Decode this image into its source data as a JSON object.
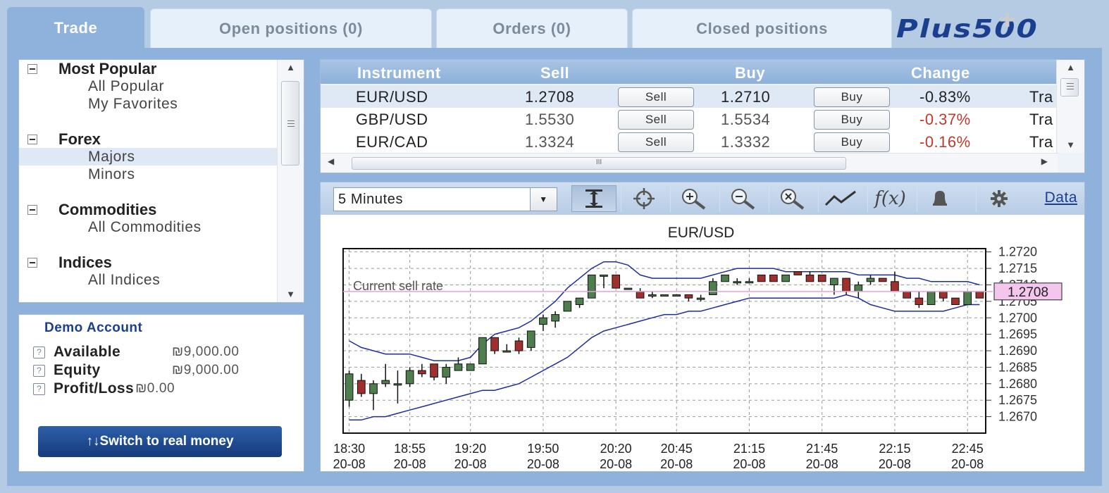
{
  "tabs": [
    {
      "label": "Trade",
      "active": true
    },
    {
      "label": "Open positions (0)",
      "active": false
    },
    {
      "label": "Orders (0)",
      "active": false
    },
    {
      "label": "Closed positions",
      "active": false
    }
  ],
  "brand": {
    "logo_text": "Plus500",
    "color": "#1b3f8f"
  },
  "tree": {
    "groups": [
      {
        "label": "Most Popular",
        "items": [
          "All Popular",
          "My Favorites"
        ]
      },
      {
        "label": "Forex",
        "items": [
          "Majors",
          "Minors"
        ],
        "selected": "Majors"
      },
      {
        "label": "Commodities",
        "items": [
          "All Commodities"
        ]
      },
      {
        "label": "Indices",
        "items": [
          "All Indices"
        ]
      }
    ]
  },
  "account": {
    "title": "Demo Account",
    "rows": [
      {
        "label": "Available",
        "value": "₪9,000.00"
      },
      {
        "label": "Equity",
        "value": "₪9,000.00"
      },
      {
        "label": "Profit/Loss",
        "value": "₪0.00"
      }
    ],
    "switch_button": "↑↓Switch to real money"
  },
  "instruments": {
    "headers": {
      "instrument": "Instrument",
      "sell": "Sell",
      "buy": "Buy",
      "change": "Change"
    },
    "rows": [
      {
        "name": "EUR/USD",
        "sell": "1.2708",
        "sell_btn": "Sell",
        "buy": "1.2710",
        "buy_btn": "Buy",
        "change": "-0.83%",
        "trade": "Tra"
      },
      {
        "name": "GBP/USD",
        "sell": "1.5530",
        "sell_btn": "Sell",
        "buy": "1.5534",
        "buy_btn": "Buy",
        "change": "-0.37%",
        "trade": "Tra"
      },
      {
        "name": "EUR/CAD",
        "sell": "1.3324",
        "sell_btn": "Sell",
        "buy": "1.3332",
        "buy_btn": "Buy",
        "change": "-0.16%",
        "trade": "Tra"
      }
    ],
    "hscroll_grip": "III",
    "colors": {
      "negative": "#c0392b"
    }
  },
  "toolbar": {
    "period": "5 Minutes",
    "tools": [
      "cursor-icon",
      "crosshair-icon",
      "zoom-in-icon",
      "zoom-out-icon",
      "zoom-reset-icon",
      "line-icon",
      "function-icon",
      "bell-icon",
      "gear-icon"
    ],
    "function_label": "f(x)",
    "data_link": "Data"
  },
  "chart_data": {
    "type": "candlestick",
    "title": "EUR/USD",
    "ylim": [
      1.2665,
      1.2721
    ],
    "yticks": [
      "1.2720",
      "1.2715",
      "1.2710",
      "1.2705",
      "1.2700",
      "1.2695",
      "1.2690",
      "1.2685",
      "1.2680",
      "1.2675",
      "1.2670"
    ],
    "xticks": [
      {
        "time": "18:30",
        "date": "20-08",
        "index": 0
      },
      {
        "time": "18:55",
        "date": "20-08",
        "index": 5
      },
      {
        "time": "19:20",
        "date": "20-08",
        "index": 10
      },
      {
        "time": "19:50",
        "date": "20-08",
        "index": 16
      },
      {
        "time": "20:20",
        "date": "20-08",
        "index": 22
      },
      {
        "time": "20:45",
        "date": "20-08",
        "index": 27
      },
      {
        "time": "21:15",
        "date": "20-08",
        "index": 33
      },
      {
        "time": "21:45",
        "date": "20-08",
        "index": 39
      },
      {
        "time": "22:15",
        "date": "20-08",
        "index": 45
      },
      {
        "time": "22:45",
        "date": "20-08",
        "index": 51
      }
    ],
    "current_rate": {
      "label": "Current sell rate",
      "value": 1.2708,
      "display": "1.2708"
    },
    "grid": true,
    "colors": {
      "up": "#4e7d4e",
      "down": "#a0302e",
      "band": "#1f2d9c",
      "rate_line": "#e3a3d6",
      "rate_badge": "#f4c6ee"
    },
    "candles": [
      {
        "o": 1.2675,
        "h": 1.2684,
        "l": 1.2673,
        "c": 1.2683
      },
      {
        "o": 1.2681,
        "h": 1.2683,
        "l": 1.2676,
        "c": 1.2677
      },
      {
        "o": 1.2677,
        "h": 1.2681,
        "l": 1.2672,
        "c": 1.268
      },
      {
        "o": 1.268,
        "h": 1.2686,
        "l": 1.2679,
        "c": 1.2681
      },
      {
        "o": 1.268,
        "h": 1.2684,
        "l": 1.2674,
        "c": 1.268
      },
      {
        "o": 1.268,
        "h": 1.2685,
        "l": 1.2679,
        "c": 1.2684
      },
      {
        "o": 1.2684,
        "h": 1.2686,
        "l": 1.2682,
        "c": 1.2683
      },
      {
        "o": 1.2686,
        "h": 1.2686,
        "l": 1.2681,
        "c": 1.2682
      },
      {
        "o": 1.2682,
        "h": 1.2686,
        "l": 1.268,
        "c": 1.2685
      },
      {
        "o": 1.2684,
        "h": 1.2688,
        "l": 1.2684,
        "c": 1.2686
      },
      {
        "o": 1.2684,
        "h": 1.2686,
        "l": 1.2684,
        "c": 1.2686
      },
      {
        "o": 1.2686,
        "h": 1.2694,
        "l": 1.2686,
        "c": 1.2694
      },
      {
        "o": 1.2694,
        "h": 1.2694,
        "l": 1.2689,
        "c": 1.269
      },
      {
        "o": 1.269,
        "h": 1.2692,
        "l": 1.269,
        "c": 1.269
      },
      {
        "o": 1.2693,
        "h": 1.2694,
        "l": 1.2689,
        "c": 1.269
      },
      {
        "o": 1.2691,
        "h": 1.2696,
        "l": 1.269,
        "c": 1.2696
      },
      {
        "o": 1.2698,
        "h": 1.2701,
        "l": 1.2696,
        "c": 1.27
      },
      {
        "o": 1.2699,
        "h": 1.2702,
        "l": 1.2697,
        "c": 1.2701
      },
      {
        "o": 1.2702,
        "h": 1.2705,
        "l": 1.2702,
        "c": 1.2705
      },
      {
        "o": 1.2704,
        "h": 1.2706,
        "l": 1.2703,
        "c": 1.2706
      },
      {
        "o": 1.2706,
        "h": 1.2713,
        "l": 1.2706,
        "c": 1.2713
      },
      {
        "o": 1.2713,
        "h": 1.2713,
        "l": 1.2709,
        "c": 1.2713
      },
      {
        "o": 1.2713,
        "h": 1.2713,
        "l": 1.2709,
        "c": 1.2709
      },
      {
        "o": 1.2709,
        "h": 1.2709,
        "l": 1.2709,
        "c": 1.2709
      },
      {
        "o": 1.2708,
        "h": 1.2709,
        "l": 1.2706,
        "c": 1.2706
      },
      {
        "o": 1.2707,
        "h": 1.2708,
        "l": 1.2706,
        "c": 1.2707
      },
      {
        "o": 1.2707,
        "h": 1.2707,
        "l": 1.2707,
        "c": 1.2707
      },
      {
        "o": 1.2707,
        "h": 1.2707,
        "l": 1.2707,
        "c": 1.2707
      },
      {
        "o": 1.2707,
        "h": 1.2707,
        "l": 1.2705,
        "c": 1.2706
      },
      {
        "o": 1.2706,
        "h": 1.2707,
        "l": 1.2705,
        "c": 1.2706
      },
      {
        "o": 1.2707,
        "h": 1.2712,
        "l": 1.2707,
        "c": 1.2711
      },
      {
        "o": 1.2711,
        "h": 1.2713,
        "l": 1.2711,
        "c": 1.2713
      },
      {
        "o": 1.2711,
        "h": 1.2712,
        "l": 1.271,
        "c": 1.2711
      },
      {
        "o": 1.2711,
        "h": 1.2712,
        "l": 1.2711,
        "c": 1.2711
      },
      {
        "o": 1.2713,
        "h": 1.2713,
        "l": 1.2711,
        "c": 1.2711
      },
      {
        "o": 1.2713,
        "h": 1.2713,
        "l": 1.2711,
        "c": 1.2711
      },
      {
        "o": 1.2711,
        "h": 1.2713,
        "l": 1.2711,
        "c": 1.2713
      },
      {
        "o": 1.2714,
        "h": 1.2714,
        "l": 1.2713,
        "c": 1.2713
      },
      {
        "o": 1.2713,
        "h": 1.2714,
        "l": 1.2711,
        "c": 1.2711
      },
      {
        "o": 1.2713,
        "h": 1.2713,
        "l": 1.2711,
        "c": 1.2711
      },
      {
        "o": 1.271,
        "h": 1.2712,
        "l": 1.2707,
        "c": 1.2712
      },
      {
        "o": 1.2712,
        "h": 1.2712,
        "l": 1.2707,
        "c": 1.2708
      },
      {
        "o": 1.2708,
        "h": 1.2711,
        "l": 1.2706,
        "c": 1.271
      },
      {
        "o": 1.2711,
        "h": 1.2713,
        "l": 1.271,
        "c": 1.2712
      },
      {
        "o": 1.2712,
        "h": 1.2712,
        "l": 1.2711,
        "c": 1.2711
      },
      {
        "o": 1.2711,
        "h": 1.2714,
        "l": 1.2708,
        "c": 1.2708
      },
      {
        "o": 1.2708,
        "h": 1.2708,
        "l": 1.2706,
        "c": 1.2706
      },
      {
        "o": 1.2706,
        "h": 1.2708,
        "l": 1.2703,
        "c": 1.2704
      },
      {
        "o": 1.2704,
        "h": 1.2708,
        "l": 1.2704,
        "c": 1.2708
      },
      {
        "o": 1.2708,
        "h": 1.2708,
        "l": 1.2705,
        "c": 1.2706
      },
      {
        "o": 1.2706,
        "h": 1.2706,
        "l": 1.2704,
        "c": 1.2704
      },
      {
        "o": 1.2704,
        "h": 1.2708,
        "l": 1.2704,
        "c": 1.2708
      },
      {
        "o": 1.2708,
        "h": 1.2708,
        "l": 1.2706,
        "c": 1.2706
      }
    ],
    "upper_band": [
      1.2693,
      1.2691,
      1.269,
      1.2689,
      1.2689,
      1.2689,
      1.2688,
      1.2687,
      1.2687,
      1.2687,
      1.2688,
      1.2692,
      1.2695,
      1.2696,
      1.2697,
      1.2699,
      1.2702,
      1.2705,
      1.2709,
      1.2712,
      1.2715,
      1.2717,
      1.2717,
      1.2716,
      1.2713,
      1.2712,
      1.2712,
      1.2712,
      1.2712,
      1.2712,
      1.2713,
      1.2714,
      1.2715,
      1.2715,
      1.2715,
      1.2715,
      1.2714,
      1.2714,
      1.2714,
      1.2714,
      1.2714,
      1.2714,
      1.2713,
      1.2713,
      1.2713,
      1.2713,
      1.2712,
      1.2712,
      1.2711,
      1.2711,
      1.2711,
      1.2711,
      1.271
    ],
    "lower_band": [
      1.2669,
      1.2669,
      1.267,
      1.267,
      1.2671,
      1.2672,
      1.2673,
      1.2674,
      1.2675,
      1.2676,
      1.2677,
      1.2678,
      1.2678,
      1.2679,
      1.268,
      1.2682,
      1.2684,
      1.2686,
      1.2688,
      1.2691,
      1.2694,
      1.2696,
      1.2697,
      1.2698,
      1.2699,
      1.27,
      1.2701,
      1.2701,
      1.2702,
      1.2702,
      1.2703,
      1.2704,
      1.2705,
      1.2706,
      1.2706,
      1.2706,
      1.2706,
      1.2706,
      1.2706,
      1.2706,
      1.2706,
      1.2707,
      1.2706,
      1.2704,
      1.2703,
      1.2702,
      1.2702,
      1.2702,
      1.2702,
      1.2702,
      1.2703,
      1.2704,
      1.2704
    ]
  }
}
